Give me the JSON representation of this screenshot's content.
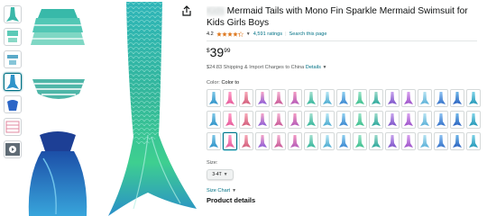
{
  "title": {
    "blurred": "Kids",
    "text": "Mermaid Tails with Mono Fin Sparkle Mermaid Swimsuit for Kids Girls Boys"
  },
  "rating": {
    "value": "4.2",
    "stars": 4.2,
    "count_text": "4,591 ratings",
    "search_link": "Search this page",
    "separator": "|"
  },
  "price": {
    "symbol": "$",
    "whole": "39",
    "fraction": "99"
  },
  "shipping": {
    "text": "$24.83 Shipping & Import Charges to China",
    "details_link": "Details"
  },
  "color": {
    "label": "Color:",
    "value": "Color to"
  },
  "size": {
    "label": "Size:",
    "selected": "3-4T"
  },
  "size_chart_link": "Size Chart",
  "product_details_heading": "Product details",
  "colors": {
    "accent_link": "#007185",
    "star": "#de7921",
    "tail_teal": "#2aa79b",
    "tail_green": "#37c79a",
    "fin_blue": "#1f6fbf"
  },
  "icons": {
    "share": "share-icon",
    "star": "star-icon",
    "chevron": "chevron-down-icon"
  }
}
